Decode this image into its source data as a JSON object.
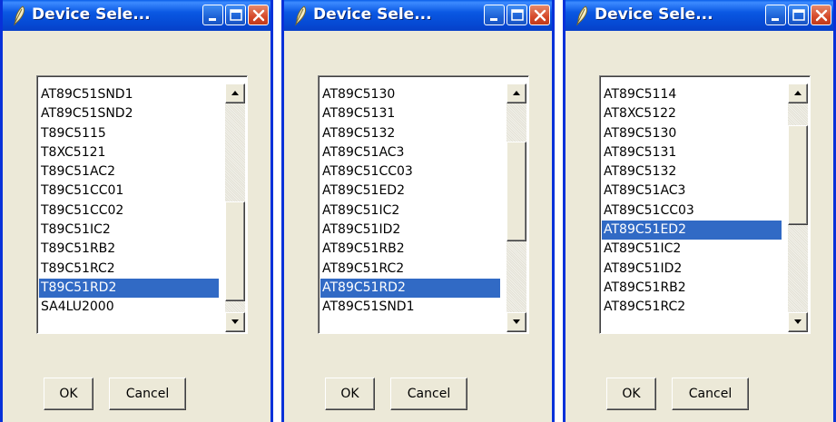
{
  "colors": {
    "window_bg": "#ece9d8",
    "titlebar_blue": "#0a58e3",
    "frame_blue": "#0831d9",
    "selection_bg": "#316ac5",
    "selection_text": "#ffffff",
    "close_red": "#d6492a"
  },
  "icons": {
    "app": "feather-icon",
    "minimize": "minimize-icon",
    "maximize": "maximize-icon",
    "close": "close-icon",
    "scroll_up": "arrow-up-icon",
    "scroll_down": "arrow-down-icon"
  },
  "windows": [
    {
      "title": "Device Sele...",
      "items": [
        "AT89C51SND1",
        "AT89C51SND2",
        "T89C5115",
        "T8XC5121",
        "T89C51AC2",
        "T89C51CC01",
        "T89C51CC02",
        "T89C51IC2",
        "T89C51RB2",
        "T89C51RC2",
        "T89C51RD2",
        "SA4LU2000"
      ],
      "selected_index": 10,
      "scroll_position": 0.9,
      "ok_label": "OK",
      "cancel_label": "Cancel"
    },
    {
      "title": "Device Sele...",
      "items": [
        "AT89C5130",
        "AT89C5131",
        "AT89C5132",
        "AT89C51AC3",
        "AT89C51CC03",
        "AT89C51ED2",
        "AT89C51IC2",
        "AT89C51ID2",
        "AT89C51RB2",
        "AT89C51RC2",
        "AT89C51RD2",
        "AT89C51SND1"
      ],
      "selected_index": 10,
      "scroll_position": 0.35,
      "ok_label": "OK",
      "cancel_label": "Cancel"
    },
    {
      "title": "Device Sele...",
      "items": [
        "AT89C5114",
        "AT8XC5122",
        "AT89C5130",
        "AT89C5131",
        "AT89C5132",
        "AT89C51AC3",
        "AT89C51CC03",
        "AT89C51ED2",
        "AT89C51IC2",
        "AT89C51ID2",
        "AT89C51RB2",
        "AT89C51RC2"
      ],
      "selected_index": 7,
      "scroll_position": 0.2,
      "ok_label": "OK",
      "cancel_label": "Cancel"
    }
  ]
}
